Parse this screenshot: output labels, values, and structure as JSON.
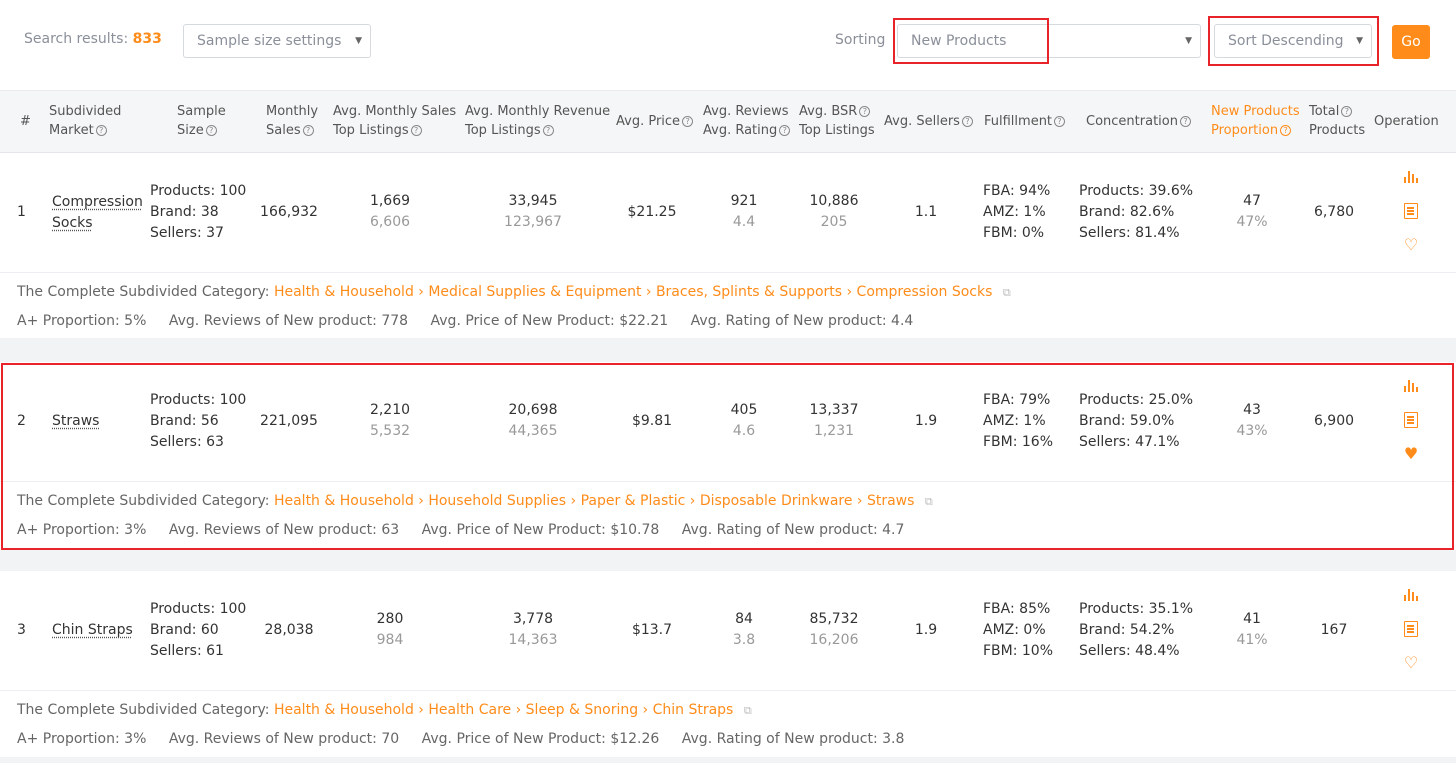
{
  "search": {
    "label": "Search results:",
    "count": "833"
  },
  "sample_select": {
    "value": "Sample size settings"
  },
  "sorting": {
    "label": "Sorting",
    "field_value": "New Products",
    "order_value": "Sort Descending",
    "go_label": "Go"
  },
  "columns": {
    "num": "#",
    "market_1": "Subdivided",
    "market_2": "Market",
    "sample_1": "Sample",
    "sample_2": "Size",
    "monthly_1": "Monthly",
    "monthly_2": "Sales",
    "avg_sales_1": "Avg. Monthly Sales",
    "avg_sales_2": "Top Listings",
    "avg_rev_1": "Avg. Monthly Revenue",
    "avg_rev_2": "Top Listings",
    "avg_price": "Avg. Price",
    "reviews_1": "Avg. Reviews",
    "reviews_2": "Avg. Rating",
    "bsr_1": "Avg. BSR",
    "bsr_2": "Top Listings",
    "sellers": "Avg. Sellers",
    "fulfillment": "Fulfillment",
    "concentration": "Concentration",
    "newprod_1": "New Products",
    "newprod_2": "Proportion",
    "total_1": "Total",
    "total_2": "Products",
    "operation": "Operation"
  },
  "detail_labels": {
    "category": "The Complete Subdivided Category:",
    "aplus": "A+ Proportion:",
    "avg_reviews_new": "Avg. Reviews of New product:",
    "avg_price_new": "Avg. Price of New Product:",
    "avg_rating_new": "Avg. Rating of New product:"
  },
  "rows": [
    {
      "num": "1",
      "market_1": "Compression",
      "market_2": "Socks",
      "products": "Products: 100",
      "brand": "Brand: 38",
      "sellers_count": "Sellers: 37",
      "monthly_sales": "166,932",
      "avg_sales": "1,669",
      "avg_sales_sub": "6,606",
      "avg_rev": "33,945",
      "avg_rev_sub": "123,967",
      "price": "$21.25",
      "reviews": "921",
      "rating": "4.4",
      "bsr": "10,886",
      "bsr_sub": "205",
      "sellers": "1.1",
      "fba": "FBA: 94%",
      "amz": "AMZ: 1%",
      "fbm": "FBM: 0%",
      "c_products": "Products: 39.6%",
      "c_brand": "Brand: 82.6%",
      "c_sellers": "Sellers: 81.4%",
      "new_count": "47",
      "new_pct": "47%",
      "total": "6,780",
      "favorite": "♡",
      "category_path": "Health & Household › Medical Supplies & Equipment › Braces, Splints & Supports › Compression Socks",
      "aplus": "5%",
      "avg_reviews_new": "778",
      "avg_price_new": "$22.21",
      "avg_rating_new": "4.4"
    },
    {
      "num": "2",
      "market_1": "Straws",
      "market_2": "",
      "products": "Products: 100",
      "brand": "Brand: 56",
      "sellers_count": "Sellers: 63",
      "monthly_sales": "221,095",
      "avg_sales": "2,210",
      "avg_sales_sub": "5,532",
      "avg_rev": "20,698",
      "avg_rev_sub": "44,365",
      "price": "$9.81",
      "reviews": "405",
      "rating": "4.6",
      "bsr": "13,337",
      "bsr_sub": "1,231",
      "sellers": "1.9",
      "fba": "FBA: 79%",
      "amz": "AMZ: 1%",
      "fbm": "FBM: 16%",
      "c_products": "Products: 25.0%",
      "c_brand": "Brand: 59.0%",
      "c_sellers": "Sellers: 47.1%",
      "new_count": "43",
      "new_pct": "43%",
      "total": "6,900",
      "favorite": "♥",
      "category_path": "Health & Household › Household Supplies › Paper & Plastic › Disposable Drinkware › Straws",
      "aplus": "3%",
      "avg_reviews_new": "63",
      "avg_price_new": "$10.78",
      "avg_rating_new": "4.7"
    },
    {
      "num": "3",
      "market_1": "Chin Straps",
      "market_2": "",
      "products": "Products: 100",
      "brand": "Brand: 60",
      "sellers_count": "Sellers: 61",
      "monthly_sales": "28,038",
      "avg_sales": "280",
      "avg_sales_sub": "984",
      "avg_rev": "3,778",
      "avg_rev_sub": "14,363",
      "price": "$13.7",
      "reviews": "84",
      "rating": "3.8",
      "bsr": "85,732",
      "bsr_sub": "16,206",
      "sellers": "1.9",
      "fba": "FBA: 85%",
      "amz": "AMZ: 0%",
      "fbm": "FBM: 10%",
      "c_products": "Products: 35.1%",
      "c_brand": "Brand: 54.2%",
      "c_sellers": "Sellers: 48.4%",
      "new_count": "41",
      "new_pct": "41%",
      "total": "167",
      "favorite": "♡",
      "category_path": "Health & Household › Health Care › Sleep & Snoring › Chin Straps",
      "aplus": "3%",
      "avg_reviews_new": "70",
      "avg_price_new": "$12.26",
      "avg_rating_new": "3.8"
    }
  ],
  "colors": {
    "accent": "#ff8c1a",
    "highlight": "#e8242a"
  }
}
